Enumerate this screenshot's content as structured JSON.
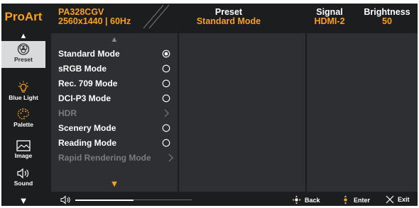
{
  "header": {
    "brand": "ProArt",
    "model": "PA328CGV",
    "resolution": "2560x1440 | 60Hz",
    "preset_title": "Preset",
    "preset_value": "Standard Mode",
    "signal_title": "Signal",
    "signal_value": "HDMI-2",
    "brightness_title": "Brightness",
    "brightness_value": "50"
  },
  "sidebar": {
    "items": [
      {
        "label": "Preset",
        "icon": "preset-icon",
        "selected": true
      },
      {
        "label": "Blue Light",
        "icon": "bulb-icon"
      },
      {
        "label": "Palette",
        "icon": "palette-icon"
      },
      {
        "label": "Image",
        "icon": "image-icon"
      },
      {
        "label": "Sound",
        "icon": "speaker-icon"
      }
    ]
  },
  "menu": {
    "items": [
      {
        "label": "Standard Mode",
        "control": "radio-selected"
      },
      {
        "label": "sRGB Mode",
        "control": "radio"
      },
      {
        "label": "Rec. 709 Mode",
        "control": "radio"
      },
      {
        "label": "DCI-P3 Mode",
        "control": "radio"
      },
      {
        "label": "HDR",
        "control": "chevron",
        "disabled": true
      },
      {
        "label": "Scenery Mode",
        "control": "radio"
      },
      {
        "label": "Reading Mode",
        "control": "radio"
      },
      {
        "label": "Rapid Rendering Mode",
        "control": "chevron",
        "disabled": true
      }
    ]
  },
  "footer": {
    "volume_level": 0.5,
    "back_label": "Back",
    "enter_label": "Enter",
    "exit_label": "Exit"
  },
  "colors": {
    "accent": "#f7a023",
    "background": "#1c1d1f",
    "panel": "#2e2f32",
    "selected_sidebar": "#d9dadb",
    "disabled_text": "#7b7c7e"
  }
}
